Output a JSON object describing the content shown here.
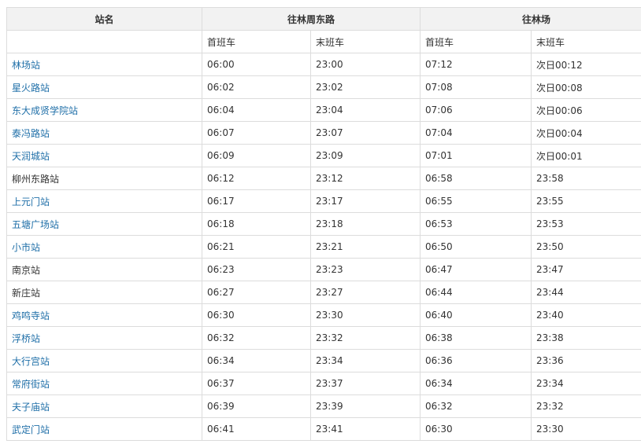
{
  "header": {
    "station_col": "站名",
    "dir1": "往林周东路",
    "dir2": "往林场",
    "first_train": "首班车",
    "last_train": "末班车"
  },
  "rows": [
    {
      "name": "林场站",
      "link": true,
      "t1": "06:00",
      "t2": "23:00",
      "t3": "07:12",
      "t4": "次日00:12"
    },
    {
      "name": "星火路站",
      "link": true,
      "t1": "06:02",
      "t2": "23:02",
      "t3": "07:08",
      "t4": "次日00:08"
    },
    {
      "name": "东大成贤学院站",
      "link": true,
      "t1": "06:04",
      "t2": "23:04",
      "t3": "07:06",
      "t4": "次日00:06"
    },
    {
      "name": "泰冯路站",
      "link": true,
      "t1": "06:07",
      "t2": "23:07",
      "t3": "07:04",
      "t4": "次日00:04"
    },
    {
      "name": "天润城站",
      "link": true,
      "t1": "06:09",
      "t2": "23:09",
      "t3": "07:01",
      "t4": "次日00:01"
    },
    {
      "name": "柳州东路站",
      "link": false,
      "t1": "06:12",
      "t2": "23:12",
      "t3": "06:58",
      "t4": "23:58"
    },
    {
      "name": "上元门站",
      "link": true,
      "t1": "06:17",
      "t2": "23:17",
      "t3": "06:55",
      "t4": "23:55"
    },
    {
      "name": "五塘广场站",
      "link": true,
      "t1": "06:18",
      "t2": "23:18",
      "t3": "06:53",
      "t4": "23:53"
    },
    {
      "name": "小市站",
      "link": true,
      "t1": "06:21",
      "t2": "23:21",
      "t3": "06:50",
      "t4": "23:50"
    },
    {
      "name": "南京站",
      "link": false,
      "t1": "06:23",
      "t2": "23:23",
      "t3": "06:47",
      "t4": "23:47"
    },
    {
      "name": "新庄站",
      "link": false,
      "t1": "06:27",
      "t2": "23:27",
      "t3": "06:44",
      "t4": "23:44"
    },
    {
      "name": "鸡鸣寺站",
      "link": true,
      "t1": "06:30",
      "t2": "23:30",
      "t3": "06:40",
      "t4": "23:40"
    },
    {
      "name": "浮桥站",
      "link": true,
      "t1": "06:32",
      "t2": "23:32",
      "t3": "06:38",
      "t4": "23:38"
    },
    {
      "name": "大行宫站",
      "link": true,
      "t1": "06:34",
      "t2": "23:34",
      "t3": "06:36",
      "t4": "23:36"
    },
    {
      "name": "常府街站",
      "link": true,
      "t1": "06:37",
      "t2": "23:37",
      "t3": "06:34",
      "t4": "23:34"
    },
    {
      "name": "夫子庙站",
      "link": true,
      "t1": "06:39",
      "t2": "23:39",
      "t3": "06:32",
      "t4": "23:32"
    },
    {
      "name": "武定门站",
      "link": true,
      "t1": "06:41",
      "t2": "23:41",
      "t3": "06:30",
      "t4": "23:30"
    }
  ],
  "colors": {
    "link": "#1f6fa8",
    "text": "#333333",
    "header_bg": "#f2f2f2",
    "border": "#dcdcdc"
  }
}
